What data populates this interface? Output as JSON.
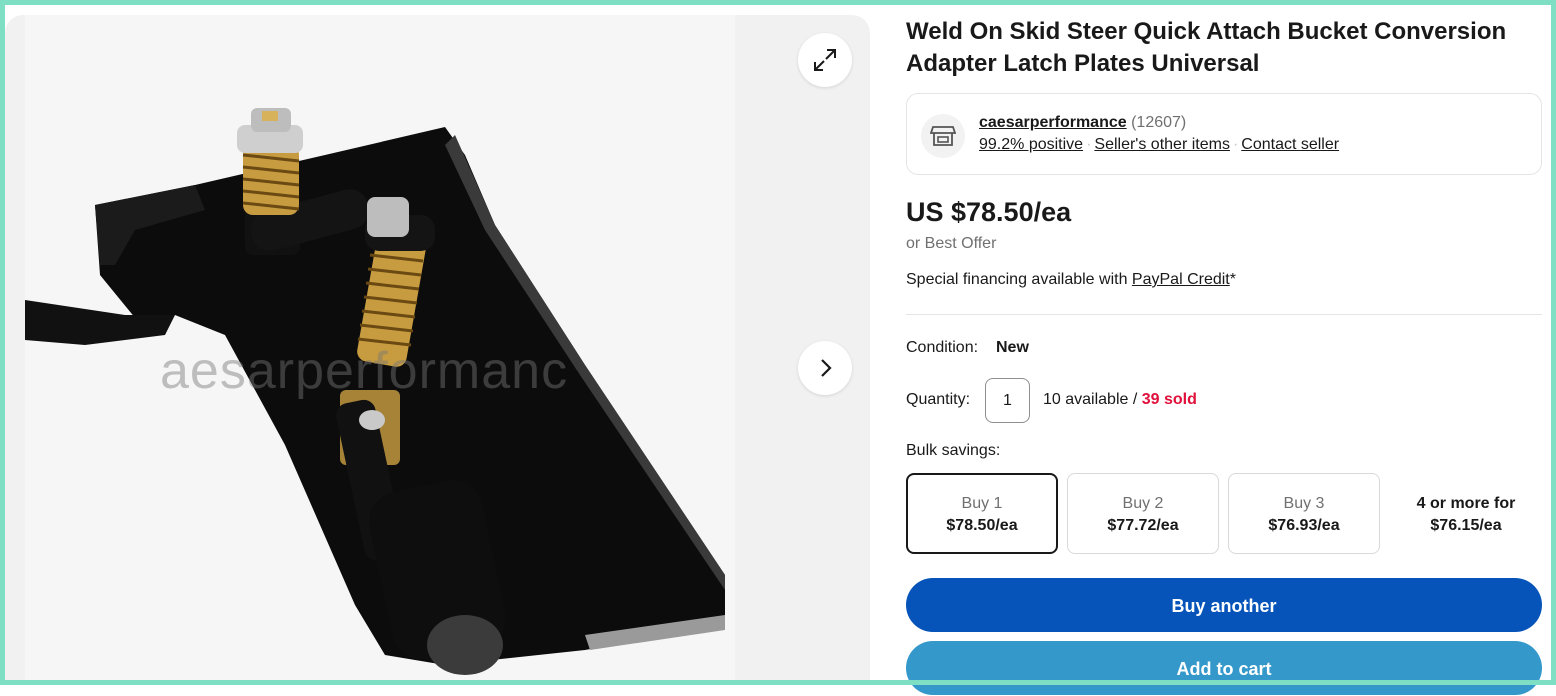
{
  "gallery": {
    "watermark": "aesarperformanc",
    "expand_icon": "expand-icon",
    "next_icon": "chevron-right-icon"
  },
  "listing": {
    "title": "Weld On Skid Steer Quick Attach Bucket Conversion Adapter Latch Plates Universal"
  },
  "seller": {
    "icon": "store-icon",
    "name": "caesarperformance",
    "feedback_count": "(12607)",
    "positive": "99.2% positive",
    "other_items": "Seller's other items",
    "contact": "Contact seller"
  },
  "price": {
    "amount": "US $78.50/ea",
    "best_offer": "or Best Offer",
    "financing_text": "Special financing available with ",
    "financing_link": "PayPal Credit",
    "financing_suffix": "*"
  },
  "condition": {
    "label": "Condition:",
    "value": "New"
  },
  "quantity": {
    "label": "Quantity:",
    "value": "1",
    "available": "10 available / ",
    "sold": "39 sold"
  },
  "bulk": {
    "label": "Bulk savings:",
    "options": [
      {
        "line1": "Buy 1",
        "line2": "$78.50/ea"
      },
      {
        "line1": "Buy 2",
        "line2": "$77.72/ea"
      },
      {
        "line1": "Buy 3",
        "line2": "$76.93/ea"
      }
    ],
    "more_line1": "4 or more for",
    "more_line2": "$76.15/ea"
  },
  "actions": {
    "buy_another": "Buy another",
    "add_to_cart": "Add to cart"
  },
  "colors": {
    "primary_button": "#0654ba",
    "secondary_button": "#3498ca",
    "sold_red": "#e0103a",
    "frame": "#7fdfc4"
  }
}
